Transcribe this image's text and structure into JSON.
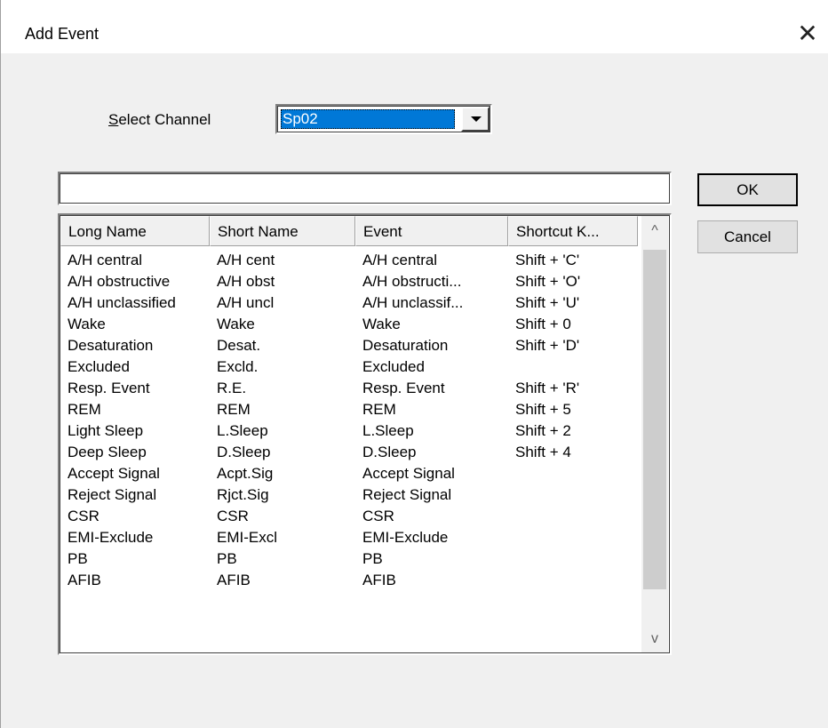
{
  "window": {
    "title": "Add Event",
    "close_glyph": "✕"
  },
  "channel": {
    "label_mnemonic": "S",
    "label_rest": "elect Channel",
    "selected_value": "Sp02"
  },
  "search": {
    "value": ""
  },
  "buttons": {
    "ok": "OK",
    "cancel": "Cancel"
  },
  "table": {
    "headers": [
      "Long Name",
      "Short Name",
      "Event",
      "Shortcut K..."
    ],
    "rows": [
      [
        "A/H central",
        "A/H cent",
        "A/H central",
        "Shift + 'C'"
      ],
      [
        "A/H obstructive",
        "A/H obst",
        "A/H obstructi...",
        "Shift + 'O'"
      ],
      [
        "A/H unclassified",
        "A/H uncl",
        "A/H unclassif...",
        "Shift + 'U'"
      ],
      [
        "Wake",
        "Wake",
        "Wake",
        "Shift + 0"
      ],
      [
        "Desaturation",
        "Desat.",
        "Desaturation",
        "Shift + 'D'"
      ],
      [
        "Excluded",
        "Excld.",
        "Excluded",
        ""
      ],
      [
        "Resp. Event",
        "R.E.",
        "Resp. Event",
        "Shift + 'R'"
      ],
      [
        "REM",
        "REM",
        "REM",
        "Shift + 5"
      ],
      [
        "Light Sleep",
        "L.Sleep",
        "L.Sleep",
        "Shift + 2"
      ],
      [
        "Deep Sleep",
        "D.Sleep",
        "D.Sleep",
        "Shift + 4"
      ],
      [
        "Accept Signal",
        "Acpt.Sig",
        "Accept Signal",
        ""
      ],
      [
        "Reject Signal",
        "Rjct.Sig",
        "Reject Signal",
        ""
      ],
      [
        "CSR",
        "CSR",
        "CSR",
        ""
      ],
      [
        "EMI-Exclude",
        "EMI-Excl",
        "EMI-Exclude",
        ""
      ],
      [
        "PB",
        "PB",
        "PB",
        ""
      ],
      [
        "AFIB",
        "AFIB",
        "AFIB",
        ""
      ]
    ]
  },
  "scrollbar": {
    "up_glyph": "^",
    "down_glyph": "v"
  },
  "colors": {
    "selection": "#0078d7",
    "dialog_bg": "#f0f0f0",
    "titlebar_bg": "#ffffff"
  }
}
